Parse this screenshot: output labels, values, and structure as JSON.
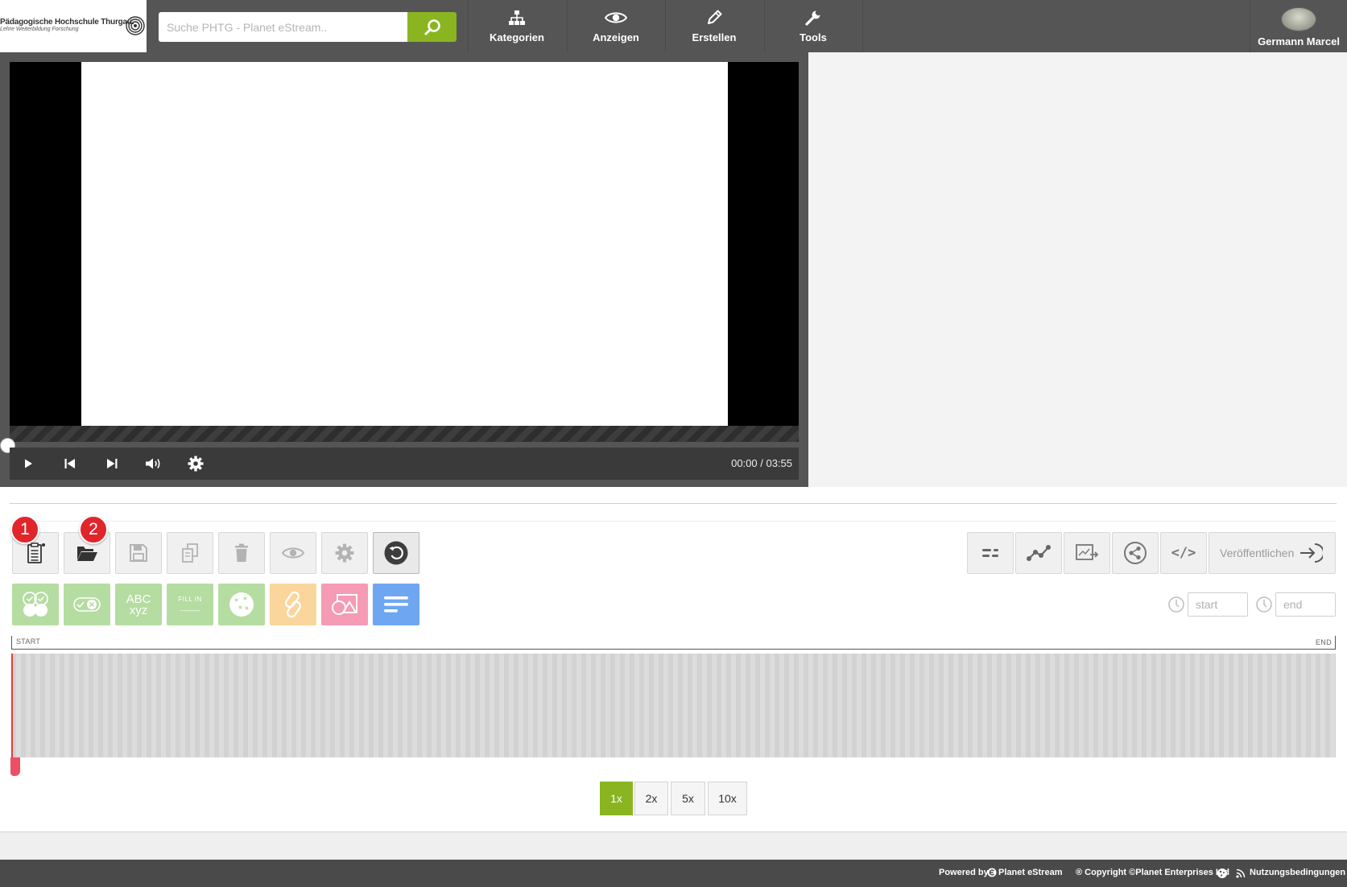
{
  "header": {
    "logo_title": "Pädagogische Hochschule Thurgau.",
    "logo_subtitle": "Lehre Weiterbildung Forschung",
    "search_placeholder": "Suche PHTG - Planet eStream..",
    "nav": [
      {
        "label": "Kategorien",
        "icon": "sitemap-icon"
      },
      {
        "label": "Anzeigen",
        "icon": "eye-icon"
      },
      {
        "label": "Erstellen",
        "icon": "pencil-icon"
      },
      {
        "label": "Tools",
        "icon": "wrench-icon"
      }
    ],
    "user_name": "Germann Marcel"
  },
  "player": {
    "time": "00:00 / 03:55",
    "progress_fraction": 0
  },
  "editor": {
    "badges": [
      "1",
      "2"
    ],
    "toolbar_icons": [
      "new-document-icon",
      "open-folder-icon",
      "save-icon",
      "copy-icon",
      "delete-icon",
      "preview-eye-icon",
      "settings-gear-icon",
      "undo-icon"
    ],
    "question_types": [
      {
        "icon": "multiple-choice-icon",
        "color": "#b5dca1"
      },
      {
        "icon": "true-false-icon",
        "color": "#b5dca1"
      },
      {
        "icon": "text-answer-icon",
        "label_top": "ABC",
        "label_bottom": "xyz",
        "color": "#b5dca1"
      },
      {
        "icon": "fill-in-icon",
        "label": "FILL IN",
        "label_line": "———",
        "color": "#b5dca1"
      },
      {
        "icon": "hotspot-icon",
        "color": "#b5dca1"
      },
      {
        "icon": "link-icon",
        "color": "#fbd69c"
      },
      {
        "icon": "image-icon",
        "color": "#f59bb5"
      },
      {
        "icon": "text-icon",
        "color": "#6ea6f2"
      }
    ],
    "right_icons": [
      "list-settings-icon",
      "path-icon",
      "chart-export-icon",
      "share-icon",
      "embed-code-icon"
    ],
    "embed_label": "</>",
    "publish_label": "Veröffentlichen",
    "start_placeholder": "start",
    "end_placeholder": "end",
    "timeline_start": "START",
    "timeline_end": "END",
    "zoom_levels": [
      "1x",
      "2x",
      "5x",
      "10x"
    ],
    "zoom_active": "1x"
  },
  "footer": {
    "powered_by": "Powered by",
    "brand": "Planet eStream",
    "copyright": "® Copyright ©Planet Enterprises Ltd",
    "terms": "Nutzungsbedingungen"
  },
  "colors": {
    "accent": "#8ab520",
    "header_bg": "#555555",
    "badge": "#e0262b",
    "playhead": "#e23c3c"
  }
}
